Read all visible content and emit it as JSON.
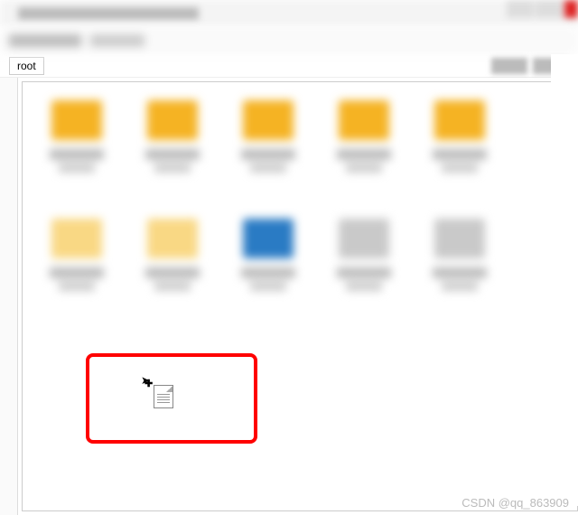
{
  "titlebar": {
    "title": ""
  },
  "path": {
    "root_label": "root"
  },
  "items": [
    {
      "type": "folder",
      "variant": ""
    },
    {
      "type": "folder",
      "variant": ""
    },
    {
      "type": "folder",
      "variant": ""
    },
    {
      "type": "folder",
      "variant": ""
    },
    {
      "type": "folder",
      "variant": ""
    },
    {
      "type": "folder",
      "variant": "light"
    },
    {
      "type": "folder",
      "variant": "light"
    },
    {
      "type": "folder",
      "variant": "blue"
    },
    {
      "type": "folder",
      "variant": "gray"
    },
    {
      "type": "folder",
      "variant": "gray"
    }
  ],
  "watermark": "CSDN @qq_863909"
}
